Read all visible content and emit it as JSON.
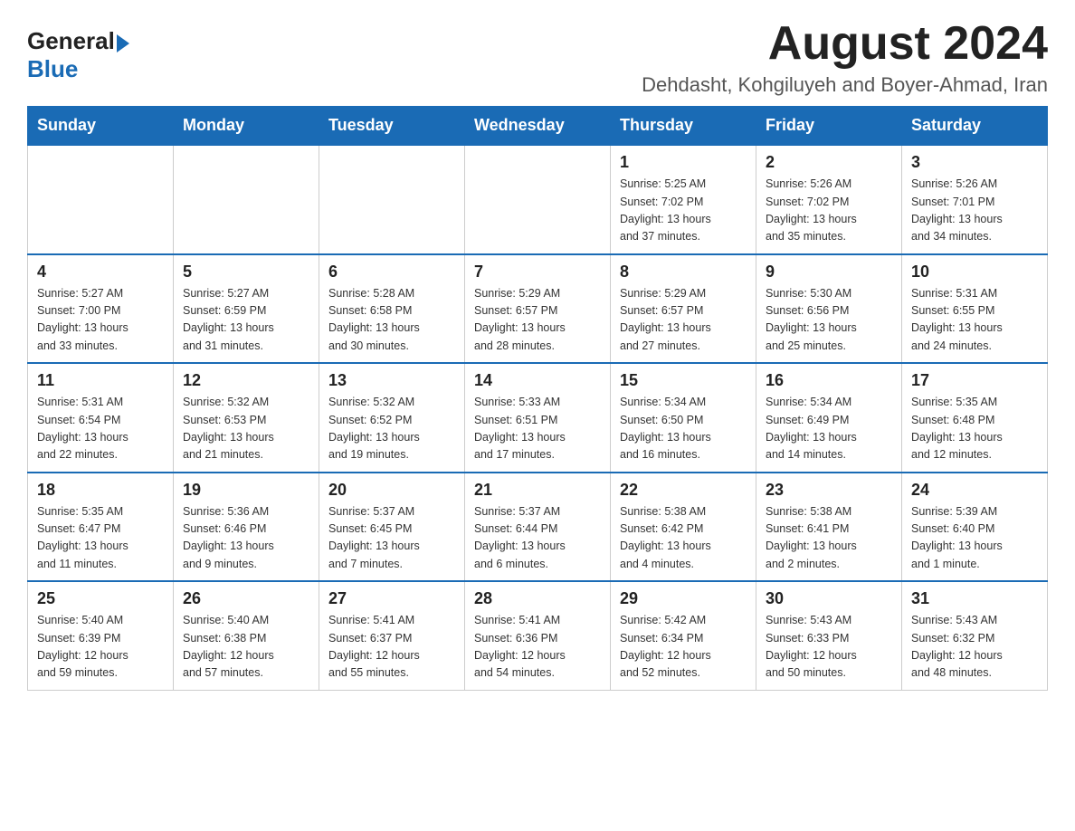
{
  "header": {
    "logo_general": "General",
    "logo_blue": "Blue",
    "title": "August 2024",
    "subtitle": "Dehdasht, Kohgiluyeh and Boyer-Ahmad, Iran"
  },
  "weekdays": [
    "Sunday",
    "Monday",
    "Tuesday",
    "Wednesday",
    "Thursday",
    "Friday",
    "Saturday"
  ],
  "weeks": [
    [
      {
        "day": "",
        "info": ""
      },
      {
        "day": "",
        "info": ""
      },
      {
        "day": "",
        "info": ""
      },
      {
        "day": "",
        "info": ""
      },
      {
        "day": "1",
        "info": "Sunrise: 5:25 AM\nSunset: 7:02 PM\nDaylight: 13 hours\nand 37 minutes."
      },
      {
        "day": "2",
        "info": "Sunrise: 5:26 AM\nSunset: 7:02 PM\nDaylight: 13 hours\nand 35 minutes."
      },
      {
        "day": "3",
        "info": "Sunrise: 5:26 AM\nSunset: 7:01 PM\nDaylight: 13 hours\nand 34 minutes."
      }
    ],
    [
      {
        "day": "4",
        "info": "Sunrise: 5:27 AM\nSunset: 7:00 PM\nDaylight: 13 hours\nand 33 minutes."
      },
      {
        "day": "5",
        "info": "Sunrise: 5:27 AM\nSunset: 6:59 PM\nDaylight: 13 hours\nand 31 minutes."
      },
      {
        "day": "6",
        "info": "Sunrise: 5:28 AM\nSunset: 6:58 PM\nDaylight: 13 hours\nand 30 minutes."
      },
      {
        "day": "7",
        "info": "Sunrise: 5:29 AM\nSunset: 6:57 PM\nDaylight: 13 hours\nand 28 minutes."
      },
      {
        "day": "8",
        "info": "Sunrise: 5:29 AM\nSunset: 6:57 PM\nDaylight: 13 hours\nand 27 minutes."
      },
      {
        "day": "9",
        "info": "Sunrise: 5:30 AM\nSunset: 6:56 PM\nDaylight: 13 hours\nand 25 minutes."
      },
      {
        "day": "10",
        "info": "Sunrise: 5:31 AM\nSunset: 6:55 PM\nDaylight: 13 hours\nand 24 minutes."
      }
    ],
    [
      {
        "day": "11",
        "info": "Sunrise: 5:31 AM\nSunset: 6:54 PM\nDaylight: 13 hours\nand 22 minutes."
      },
      {
        "day": "12",
        "info": "Sunrise: 5:32 AM\nSunset: 6:53 PM\nDaylight: 13 hours\nand 21 minutes."
      },
      {
        "day": "13",
        "info": "Sunrise: 5:32 AM\nSunset: 6:52 PM\nDaylight: 13 hours\nand 19 minutes."
      },
      {
        "day": "14",
        "info": "Sunrise: 5:33 AM\nSunset: 6:51 PM\nDaylight: 13 hours\nand 17 minutes."
      },
      {
        "day": "15",
        "info": "Sunrise: 5:34 AM\nSunset: 6:50 PM\nDaylight: 13 hours\nand 16 minutes."
      },
      {
        "day": "16",
        "info": "Sunrise: 5:34 AM\nSunset: 6:49 PM\nDaylight: 13 hours\nand 14 minutes."
      },
      {
        "day": "17",
        "info": "Sunrise: 5:35 AM\nSunset: 6:48 PM\nDaylight: 13 hours\nand 12 minutes."
      }
    ],
    [
      {
        "day": "18",
        "info": "Sunrise: 5:35 AM\nSunset: 6:47 PM\nDaylight: 13 hours\nand 11 minutes."
      },
      {
        "day": "19",
        "info": "Sunrise: 5:36 AM\nSunset: 6:46 PM\nDaylight: 13 hours\nand 9 minutes."
      },
      {
        "day": "20",
        "info": "Sunrise: 5:37 AM\nSunset: 6:45 PM\nDaylight: 13 hours\nand 7 minutes."
      },
      {
        "day": "21",
        "info": "Sunrise: 5:37 AM\nSunset: 6:44 PM\nDaylight: 13 hours\nand 6 minutes."
      },
      {
        "day": "22",
        "info": "Sunrise: 5:38 AM\nSunset: 6:42 PM\nDaylight: 13 hours\nand 4 minutes."
      },
      {
        "day": "23",
        "info": "Sunrise: 5:38 AM\nSunset: 6:41 PM\nDaylight: 13 hours\nand 2 minutes."
      },
      {
        "day": "24",
        "info": "Sunrise: 5:39 AM\nSunset: 6:40 PM\nDaylight: 13 hours\nand 1 minute."
      }
    ],
    [
      {
        "day": "25",
        "info": "Sunrise: 5:40 AM\nSunset: 6:39 PM\nDaylight: 12 hours\nand 59 minutes."
      },
      {
        "day": "26",
        "info": "Sunrise: 5:40 AM\nSunset: 6:38 PM\nDaylight: 12 hours\nand 57 minutes."
      },
      {
        "day": "27",
        "info": "Sunrise: 5:41 AM\nSunset: 6:37 PM\nDaylight: 12 hours\nand 55 minutes."
      },
      {
        "day": "28",
        "info": "Sunrise: 5:41 AM\nSunset: 6:36 PM\nDaylight: 12 hours\nand 54 minutes."
      },
      {
        "day": "29",
        "info": "Sunrise: 5:42 AM\nSunset: 6:34 PM\nDaylight: 12 hours\nand 52 minutes."
      },
      {
        "day": "30",
        "info": "Sunrise: 5:43 AM\nSunset: 6:33 PM\nDaylight: 12 hours\nand 50 minutes."
      },
      {
        "day": "31",
        "info": "Sunrise: 5:43 AM\nSunset: 6:32 PM\nDaylight: 12 hours\nand 48 minutes."
      }
    ]
  ]
}
